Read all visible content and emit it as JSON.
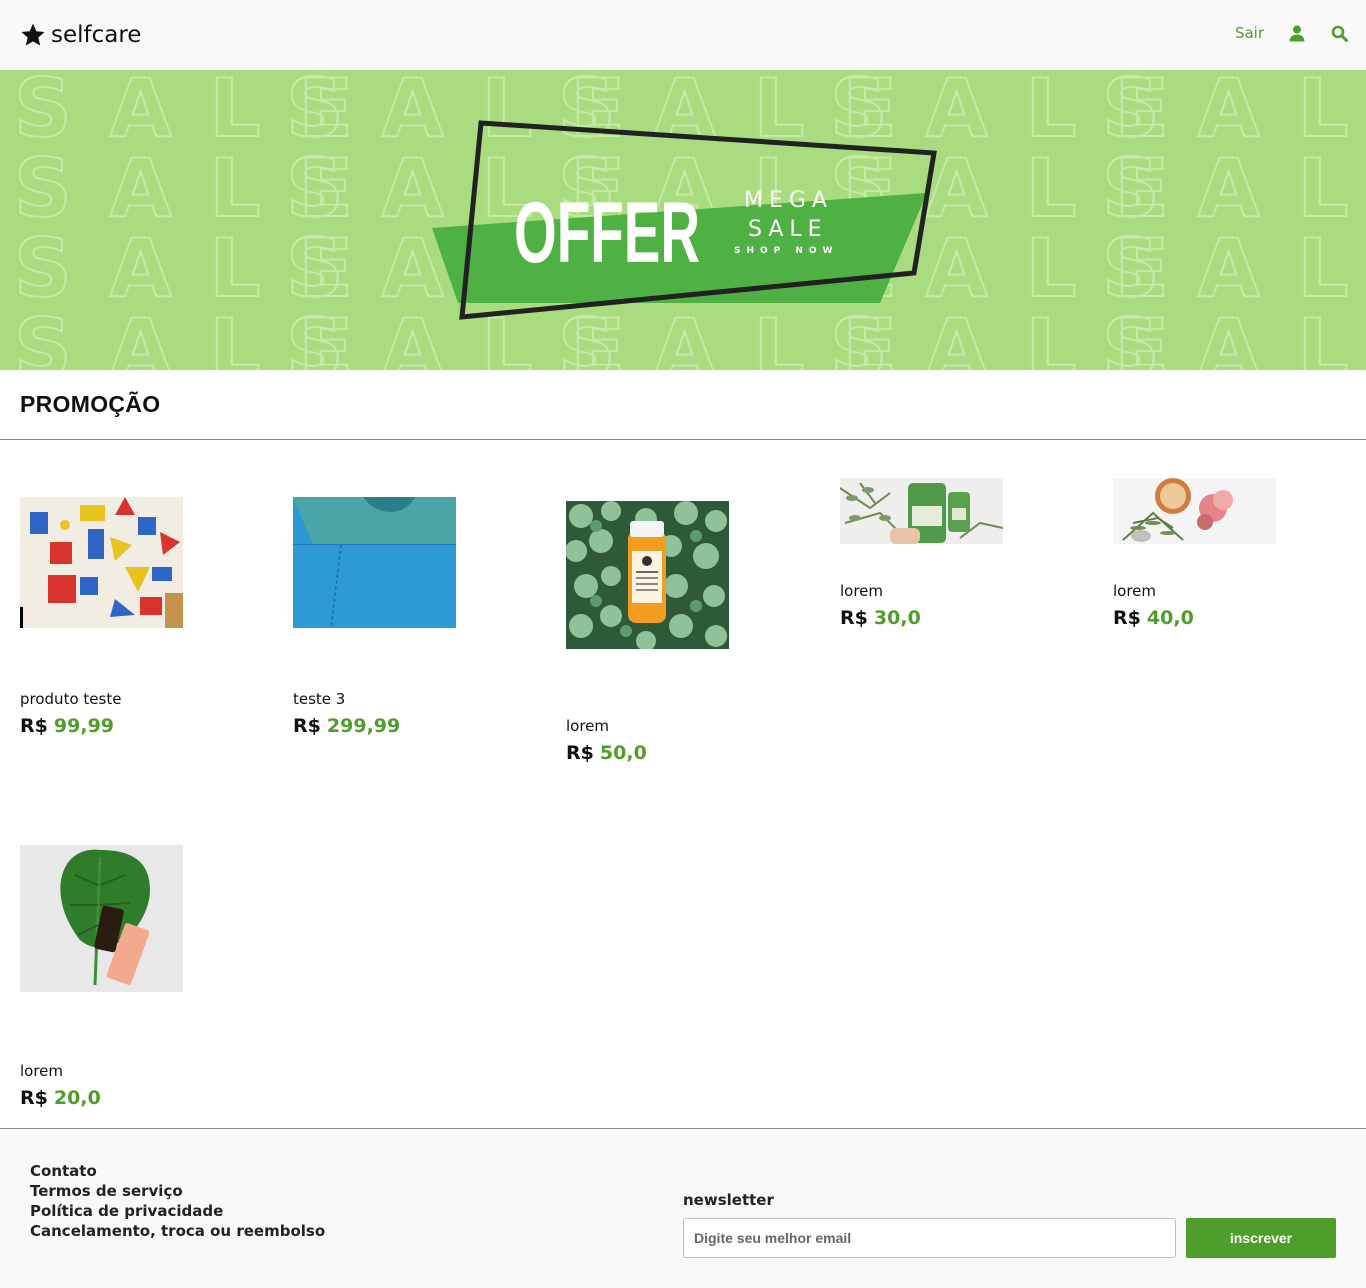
{
  "header": {
    "brand": "selfcare",
    "logo_icon": "star-icon",
    "logout_label": "Sair",
    "user_icon": "user-icon",
    "search_icon": "search-icon"
  },
  "banner": {
    "background_word": "SALE",
    "offer_text": "OFFER",
    "mega_text": "MEGA",
    "sale_text": "SALE",
    "shop_now_text": "SHOP NOW",
    "colors": {
      "background": "#a9dc7e",
      "tag": "#4fb043"
    }
  },
  "section": {
    "title": "PROMOÇÃO"
  },
  "products": [
    {
      "name": "produto teste",
      "currency": "R$",
      "price": "99,99"
    },
    {
      "name": "teste 3",
      "currency": "R$",
      "price": "299,99"
    },
    {
      "name": "lorem",
      "currency": "R$",
      "price": "50,0"
    },
    {
      "name": "lorem",
      "currency": "R$",
      "price": "30,0"
    },
    {
      "name": "lorem",
      "currency": "R$",
      "price": "40,0"
    },
    {
      "name": "lorem",
      "currency": "R$",
      "price": "20,0"
    }
  ],
  "footer": {
    "links": [
      "Contato",
      "Termos de serviço",
      "Política de privacidade",
      "Cancelamento, troca ou reembolso"
    ],
    "newsletter_label": "newsletter",
    "email_placeholder": "Digite seu melhor email",
    "subscribe_label": "inscrever"
  },
  "colors": {
    "accent": "#4f9e2b",
    "header_bg": "#f9f9f9"
  }
}
